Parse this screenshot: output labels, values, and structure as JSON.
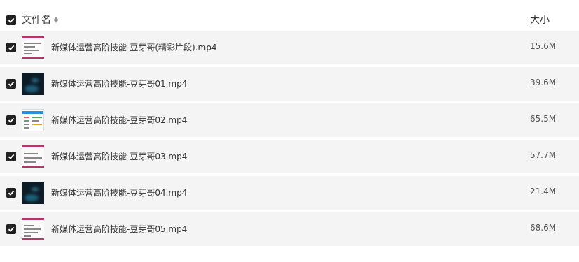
{
  "header": {
    "name_label": "文件名",
    "size_label": "大小",
    "select_all_checked": true
  },
  "files": [
    {
      "name": "新媒体运营高阶技能-豆芽哥(精彩片段).mp4",
      "size": "15.6M",
      "thumb": "doc",
      "checked": true
    },
    {
      "name": "新媒体运营高阶技能-豆芽哥01.mp4",
      "size": "39.6M",
      "thumb": "dark",
      "checked": true
    },
    {
      "name": "新媒体运营高阶技能-豆芽哥02.mp4",
      "size": "65.5M",
      "thumb": "table",
      "checked": true
    },
    {
      "name": "新媒体运营高阶技能-豆芽哥03.mp4",
      "size": "57.7M",
      "thumb": "doc",
      "checked": true
    },
    {
      "name": "新媒体运营高阶技能-豆芽哥04.mp4",
      "size": "21.4M",
      "thumb": "dark",
      "checked": true
    },
    {
      "name": "新媒体运营高阶技能-豆芽哥05.mp4",
      "size": "68.6M",
      "thumb": "doc",
      "checked": true
    }
  ]
}
